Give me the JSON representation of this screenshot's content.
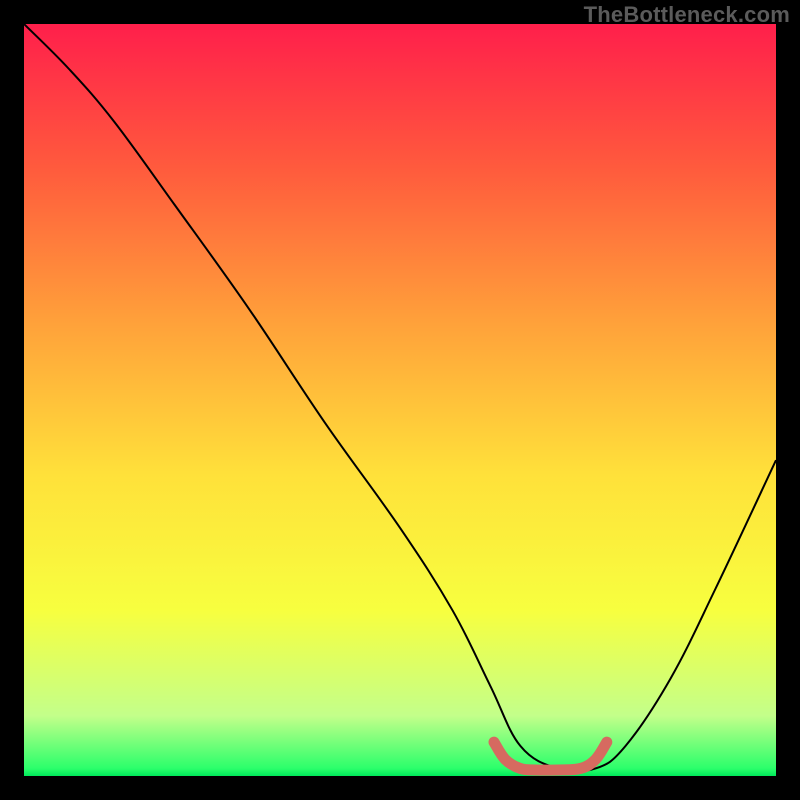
{
  "watermark": "TheBottleneck.com",
  "chart_data": {
    "type": "line",
    "title": "",
    "xlabel": "",
    "ylabel": "",
    "xlim": [
      0,
      100
    ],
    "ylim": [
      0,
      100
    ],
    "annotations": [],
    "gradient_stops": [
      {
        "offset": 0,
        "color": "#ff1f4b"
      },
      {
        "offset": 0.19,
        "color": "#ff5a3d"
      },
      {
        "offset": 0.4,
        "color": "#ffa23a"
      },
      {
        "offset": 0.6,
        "color": "#ffe13a"
      },
      {
        "offset": 0.78,
        "color": "#f7ff3f"
      },
      {
        "offset": 0.92,
        "color": "#c3ff8a"
      },
      {
        "offset": 0.99,
        "color": "#2bff6b"
      },
      {
        "offset": 1.0,
        "color": "#00e85a"
      }
    ],
    "series": [
      {
        "name": "curve",
        "x": [
          0,
          6,
          12,
          20,
          30,
          40,
          50,
          57,
          62,
          66,
          71,
          76,
          80,
          86,
          92,
          100
        ],
        "y": [
          100,
          94,
          87,
          76,
          62,
          47,
          33,
          22,
          12,
          4,
          1,
          1,
          4,
          13,
          25,
          42
        ]
      }
    ],
    "highlight_segment": {
      "color": "#d66a60",
      "x": [
        62.5,
        64,
        66,
        68,
        71,
        74,
        76,
        77.5
      ],
      "y": [
        4.5,
        2.2,
        1.0,
        0.8,
        0.8,
        1.0,
        2.2,
        4.5
      ]
    }
  }
}
